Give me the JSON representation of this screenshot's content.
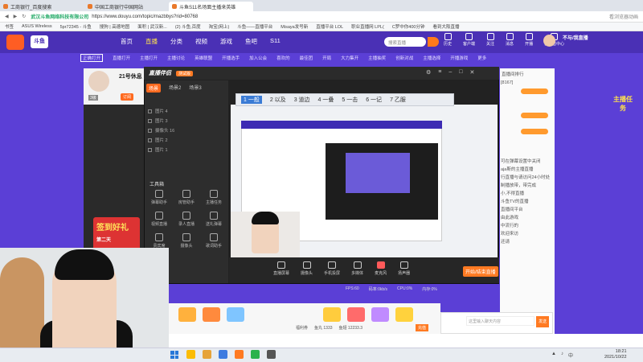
{
  "browser": {
    "tabs": [
      "工商银行_百度搜索",
      "中国工商银行中国网站",
      "斗鱼S11名场面主播来英雄"
    ],
    "url_host": "https://www.douyu.com/topic/mazbbys?rid=80768",
    "url_site": "武汉斗鱼网络科技有限公司",
    "address_hint": "看浏览器动画",
    "bookmarks": [
      "书签",
      "ASUS Wireless",
      "5pr72345 - 斗鱼",
      "搜狗 | 高德地图",
      "面积 | 武汉新...",
      "(2) 斗鱼,百度",
      "淘宝(网上)",
      "斗鱼——直播平台",
      "Misaya发号新",
      "直播平台 LOL",
      "职业直播网 LPL(",
      "C罗中你400分钟",
      "看到大阪直播"
    ]
  },
  "site": {
    "logo": "斗鱼",
    "nav": [
      "首页",
      "直播",
      "分类",
      "视频",
      "游戏",
      "鱼吧",
      "S11"
    ],
    "search_placeholder": "搜索直播",
    "tools": [
      "历史",
      "客户端",
      "关注",
      "消息",
      "开播",
      "创作者中心"
    ],
    "slogan": "不与/我直播",
    "subnav": [
      "正确打开",
      "直播打开",
      "主播打开",
      "主播讨论",
      "英雄联盟",
      "开播选手",
      "加入公会",
      "喜欢的",
      "最佳团",
      "开局",
      "大力集开",
      "主播抽奖",
      "创新对战",
      "主播选择",
      "开播游戏",
      "更多"
    ]
  },
  "room": {
    "title": "21号休息",
    "level": "3级",
    "follow": "订阅",
    "sign_title": "签到好礼",
    "sign_sub": "第二天"
  },
  "obs": {
    "brand": "直播伴侣",
    "badge": "测试版",
    "scene_tabs": [
      "场景",
      "场景2",
      "场景3"
    ],
    "layers": [
      "图片 4",
      "图片 3",
      "摄像头 16",
      "图片 2",
      "图片 1"
    ],
    "tools_title": "工具箱",
    "tools": [
      "弹幕助手",
      "房管助手",
      "主播任务",
      "视频直播",
      "录人直播",
      "送礼弹幕",
      "贵宾席",
      "摄像头",
      "歌词助手"
    ],
    "controls": [
      "直播屏幕",
      "摄像头",
      "手机投屏",
      "多媒体",
      "麦克风",
      "扬声器"
    ],
    "stop": "开始/结束直播",
    "stats": [
      "FPS:60",
      "码率:0kb/s",
      "CPU:0%",
      "内存:0%"
    ]
  },
  "ime": {
    "candidates": [
      "1 一般",
      "2 以及",
      "3 道边",
      "4 一叠",
      "5 一击",
      "6 一记",
      "7 乙服"
    ]
  },
  "chat": {
    "header": "直播间排行",
    "lines": [
      "[8167]",
      "贡献值",
      "主播:",
      "无线",
      "弹幕",
      "可在弹幕设置中关闭",
      "aja斯的主播直播",
      "行直播与请访问24小时处",
      "制播放带，带完成",
      "小,不得直播",
      "斗鱼TV的直播",
      "直播间平台",
      "由此游戏",
      "中流行的",
      "欢迎来访",
      "还请"
    ],
    "input_placeholder": "这里输入聊天内容",
    "send": "发送",
    "rank": "主播任务"
  },
  "gift": {
    "footer": [
      "福利券",
      "鱼丸 1333",
      "鱼翅 12233.3"
    ],
    "recharge": "充值"
  },
  "taskbar": {
    "time": "18:21",
    "date": "2021/10/22",
    "tray": "中"
  }
}
